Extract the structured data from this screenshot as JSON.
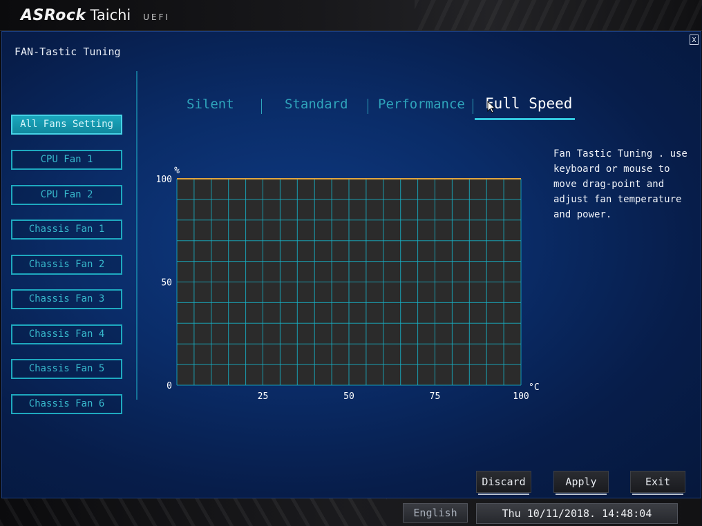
{
  "header": {
    "brand": "ASRock",
    "model": "Taichi",
    "firmware": "UEFI"
  },
  "panel": {
    "title": "FAN-Tastic Tuning",
    "close_label": "X"
  },
  "sidebar": {
    "items": [
      {
        "label": "All Fans Setting",
        "active": true
      },
      {
        "label": "CPU Fan 1",
        "active": false
      },
      {
        "label": "CPU Fan 2",
        "active": false
      },
      {
        "label": "Chassis Fan 1",
        "active": false
      },
      {
        "label": "Chassis Fan 2",
        "active": false
      },
      {
        "label": "Chassis Fan 3",
        "active": false
      },
      {
        "label": "Chassis Fan 4",
        "active": false
      },
      {
        "label": "Chassis Fan 5",
        "active": false
      },
      {
        "label": "Chassis Fan 6",
        "active": false
      }
    ]
  },
  "modes": {
    "tabs": [
      {
        "label": "Silent"
      },
      {
        "label": "Standard"
      },
      {
        "label": "Performance"
      },
      {
        "label": "Full Speed"
      }
    ],
    "selected": "Full Speed"
  },
  "chart_data": {
    "type": "line",
    "title": "",
    "xlabel": "°C",
    "ylabel": "%",
    "xlim": [
      0,
      100
    ],
    "ylim": [
      0,
      100
    ],
    "x_ticks": [
      0,
      25,
      50,
      75,
      100
    ],
    "y_ticks": [
      0,
      50,
      100
    ],
    "x_tick_labels": [
      "25",
      "50",
      "75",
      "100"
    ],
    "y_tick_labels": [
      "0",
      "50",
      "100"
    ],
    "grid": true,
    "series": [
      {
        "x": [
          0,
          100
        ],
        "y": [
          100,
          100
        ]
      }
    ],
    "colors": {
      "plot_bg": "#2b2b2b",
      "grid": "#17b3c8",
      "curve": "#e0a640"
    }
  },
  "help": {
    "text": "Fan Tastic Tuning . use\nkeyboard or mouse to\nmove drag-point and\nadjust fan temperature\nand power."
  },
  "actions": {
    "discard_label": "Discard",
    "apply_label": "Apply",
    "exit_label": "Exit"
  },
  "footer": {
    "language": "English",
    "datetime": "Thu 10/11/2018. 14:48:04"
  }
}
